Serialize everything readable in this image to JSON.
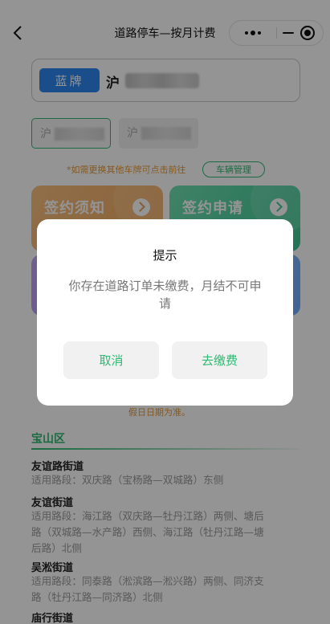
{
  "nav": {
    "title": "道路停车—按月计费"
  },
  "plate": {
    "tag": "蓝牌",
    "prefix": "沪"
  },
  "chips": [
    {
      "prefix": "沪"
    },
    {
      "prefix": "沪"
    }
  ],
  "hint": {
    "text": "*如需更换其他车牌可点击前往",
    "manage_label": "车辆管理"
  },
  "cards": {
    "notice_title": "签约须知",
    "apply_title": "签约申请"
  },
  "notice_tail": "假日日期为准。",
  "district": {
    "name": "宝山区",
    "streets": [
      {
        "name": "友谊路街道",
        "roads": [
          "适用路段：双庆路（宝杨路—双城路）东侧"
        ]
      },
      {
        "name": "友谊街道",
        "roads": [
          "适用路段：海江路（双庆路—牡丹江路）两侧、塘后",
          "路（双城路—水产路）西侧、海江路（牡丹江路—塘",
          "后路）北侧"
        ]
      },
      {
        "name": "吴淞街道",
        "roads": [
          "适用路段：同泰路（淞滨路—淞兴路）两侧、同济支",
          "路（牡丹江路—同济路）北侧"
        ]
      },
      {
        "name": "庙行街道",
        "roads": []
      }
    ]
  },
  "dialog": {
    "title": "提示",
    "message": "你存在道路订单未缴费，月结不可申请",
    "cancel": "取消",
    "pay": "去缴费"
  },
  "colors": {
    "accent": "#2fb972",
    "blue": "#2b87f0",
    "orange": "#e49a3a"
  }
}
